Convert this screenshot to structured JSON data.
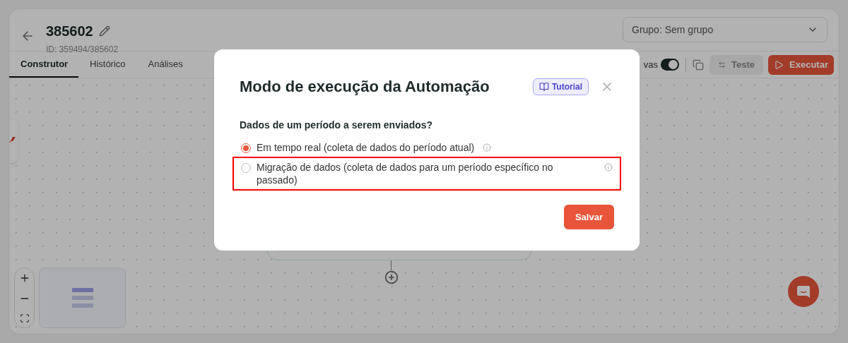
{
  "header": {
    "title": "385602",
    "subtitle": "ID: 359494/385602"
  },
  "group_select": {
    "value": "Grupo: Sem grupo"
  },
  "tabs": [
    {
      "label": "Construtor",
      "selected": true
    },
    {
      "label": "Histórico",
      "selected": false
    },
    {
      "label": "Análises",
      "selected": false
    }
  ],
  "toolbar": {
    "toggle_label": "vas",
    "toggle_on": true,
    "buttons": [
      {
        "label": "Teste",
        "kind": "secondary"
      },
      {
        "label": "Executar",
        "kind": "primary"
      }
    ]
  },
  "modal": {
    "title": "Modo de execução da Automação",
    "tutorial_label": "Tutorial",
    "question": "Dados de um período a serem enviados?",
    "options": [
      {
        "label": "Em tempo real (coleta de dados do período atual)",
        "selected": true,
        "highlighted": false
      },
      {
        "label": "Migração de dados (coleta de dados para um período específico no passado)",
        "selected": false,
        "highlighted": true
      }
    ],
    "save_label": "Salvar"
  }
}
